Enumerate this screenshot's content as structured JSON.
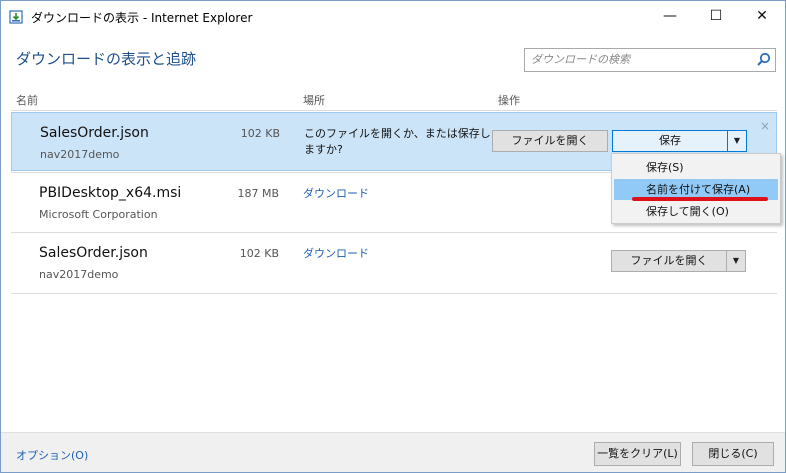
{
  "window": {
    "title": "ダウンロードの表示 - Internet Explorer",
    "minimize": "—",
    "maximize": "☐",
    "close": "✕"
  },
  "header": {
    "title": "ダウンロードの表示と追跡",
    "search_placeholder": "ダウンロードの検索"
  },
  "columns": {
    "name": "名前",
    "location": "場所",
    "action": "操作"
  },
  "downloads": [
    {
      "name": "SalesOrder.json",
      "source": "nav2017demo",
      "size": "102 KB",
      "message": "このファイルを開くか、または保存しますか?",
      "open_label": "ファイルを開く",
      "save_label": "保存",
      "arrow": "▼",
      "dismiss": "×"
    },
    {
      "name": "PBIDesktop_x64.msi",
      "source": "Microsoft Corporation",
      "size": "187 MB",
      "location": "ダウンロード"
    },
    {
      "name": "SalesOrder.json",
      "source": "nav2017demo",
      "size": "102 KB",
      "location": "ダウンロード",
      "open_label": "ファイルを開く",
      "arrow": "▼"
    }
  ],
  "save_menu": {
    "items": [
      "保存(S)",
      "名前を付けて保存(A)",
      "保存して開く(O)"
    ],
    "highlighted_index": 1
  },
  "footer": {
    "options": "オプション(O)",
    "clear_list": "一覧をクリア(L)",
    "close": "閉じる(C)"
  },
  "colors": {
    "accent": "#1e4e8c",
    "link": "#1a5fb4",
    "selected_row": "#cce4f7",
    "menu_highlight": "#91c9f7",
    "annotation": "#e0101a"
  }
}
